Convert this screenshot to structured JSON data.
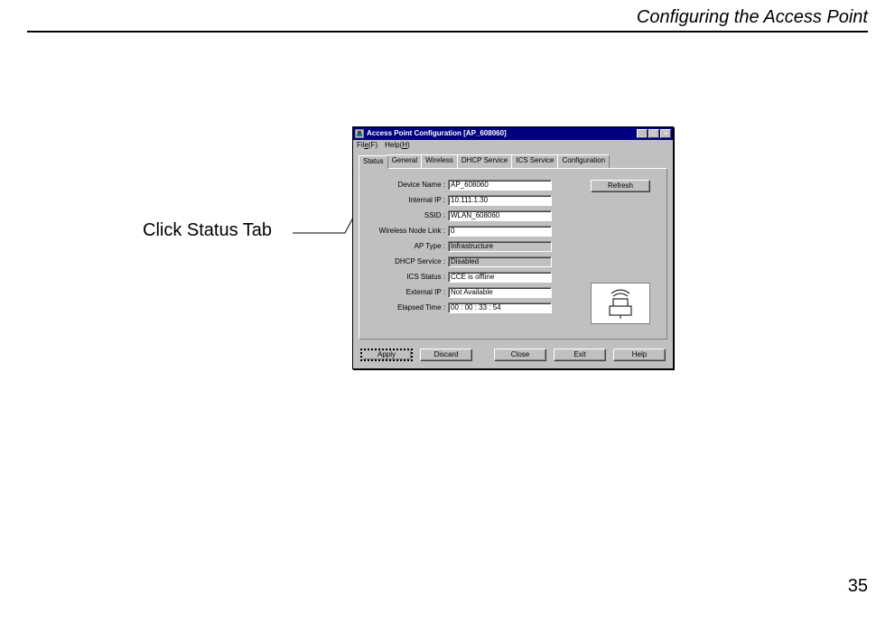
{
  "page": {
    "header": "Configuring the Access Point",
    "number": "35"
  },
  "callout": "Click Status Tab",
  "window": {
    "title": "Access Point Configuration [AP_608060]",
    "menu": {
      "file": "File(F)",
      "help": "Help(H)"
    },
    "tabs": [
      "Status",
      "General",
      "Wireless",
      "DHCP Service",
      "ICS Service",
      "Configuration"
    ],
    "fields": {
      "device_name": {
        "label": "Device Name :",
        "value": "AP_608060"
      },
      "internal_ip": {
        "label": "Internal IP :",
        "value": "10.111.1.30"
      },
      "ssid": {
        "label": "SSID :",
        "value": "WLAN_608060"
      },
      "node_link": {
        "label": "Wireless Node Link :",
        "value": "0"
      },
      "ap_type": {
        "label": "AP Type :",
        "value": "Infrastructure"
      },
      "dhcp": {
        "label": "DHCP Service :",
        "value": "Disabled"
      },
      "ics": {
        "label": "ICS Status :",
        "value": "CCE is offline"
      },
      "ext_ip": {
        "label": "External IP :",
        "value": "Not Available"
      },
      "elapsed": {
        "label": "Elapsed Time :",
        "value": "00 : 00 : 33 : 54"
      }
    },
    "buttons": {
      "refresh": "Refresh",
      "apply": "Apply",
      "discard": "Discard",
      "close": "Close",
      "exit": "Exit",
      "help": "Help"
    },
    "winbtns": {
      "min": "_",
      "max": "□",
      "close": "×"
    }
  }
}
